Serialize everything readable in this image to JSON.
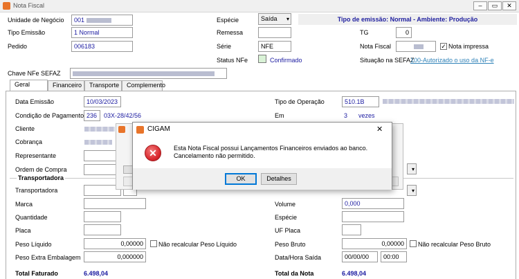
{
  "window": {
    "title": "Nota Fiscal",
    "icon": "app-icon"
  },
  "header": {
    "unidade_negocio_label": "Unidade de Negócio",
    "unidade_negocio_value": "001",
    "especie_label": "Espécie",
    "especie_value": "Saída",
    "tipo_emissao_banner": "Tipo de emissão: Normal - Ambiente: Produção",
    "tipo_emissao_label": "Tipo Emissão",
    "tipo_emissao_value": "1 Normal",
    "remessa_label": "Remessa",
    "remessa_value": "",
    "tg_label": "TG",
    "tg_value": "0",
    "pedido_label": "Pedido",
    "pedido_value": "006183",
    "serie_label": "Série",
    "serie_value": "NFE",
    "nota_fiscal_label": "Nota Fiscal",
    "nota_impressa_label": "Nota impressa",
    "status_nfe_label": "Status NFe",
    "status_nfe_value": "Confirmado",
    "situacao_sefaz_label": "Situação na SEFAZ",
    "situacao_sefaz_link": "100-Autorizado o uso da NF-e",
    "chave_nfe_label": "Chave NFe SEFAZ"
  },
  "tabs": [
    "Geral",
    "Financeiro",
    "Transporte",
    "Complemento"
  ],
  "geral": {
    "data_emissao_label": "Data Emissão",
    "data_emissao_value": "10/03/2023",
    "tipo_operacao_label": "Tipo de Operação",
    "tipo_operacao_value": "510.1B",
    "condicao_pagamento_label": "Condição de Pagamento",
    "condicao_pagamento_code": "236",
    "condicao_pagamento_desc": "03X-28/42/56",
    "em_label": "Em",
    "em_value": "3",
    "em_unit": "vezes",
    "cliente_label": "Cliente",
    "cobranca_label": "Cobrança",
    "representante_label": "Representante",
    "ordem_compra_label": "Ordem de Compra"
  },
  "transportadora": {
    "section_label": "Transportadora",
    "transportadora_label": "Transportadora",
    "marca_label": "Marca",
    "volume_label": "Volume",
    "volume_value": "0,000",
    "quantidade_label": "Quantidade",
    "especie_label": "Espécie",
    "placa_label": "Placa",
    "uf_placa_label": "UF Placa",
    "peso_liquido_label": "Peso Líquido",
    "peso_liquido_value": "0,00000",
    "nao_recalcular_liquido_label": "Não recalcular Peso Líquido",
    "peso_bruto_label": "Peso Bruto",
    "peso_bruto_value": "0,00000",
    "nao_recalcular_bruto_label": "Não recalcular Peso Bruto",
    "peso_extra_label": "Peso Extra Embalagem",
    "peso_extra_value": "0,000000",
    "data_hora_saida_label": "Data/Hora Saída",
    "data_saida_value": "00/00/00",
    "hora_saida_value": "00:00"
  },
  "totals": {
    "total_faturado_label": "Total Faturado",
    "total_faturado_value": "6.498,04",
    "total_nota_label": "Total da Nota",
    "total_nota_value": "6.498,04"
  },
  "dialog": {
    "title": "CIGAM",
    "message_line1": "Esta Nota Fiscal possui Lançamentos Financeiros enviados ao banco.",
    "message_line2": "Cancelamento não permitido.",
    "ok_label": "OK",
    "detalhes_label": "Detalhes",
    "close_glyph": "✕",
    "icon": "error-icon"
  },
  "colors": {
    "banner_text": "#1f1f9f",
    "link": "#2f82b8",
    "field_blue": "#1a1aa0",
    "error_red": "#d9262c"
  }
}
